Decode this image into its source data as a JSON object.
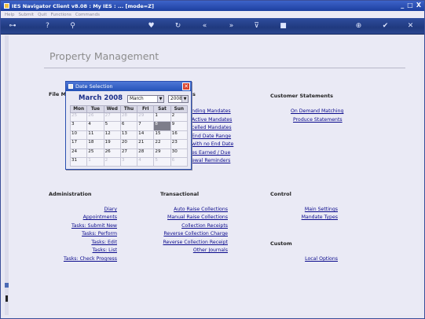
{
  "window": {
    "title": "IES Navigator Client v8.08 : My IES : ... [mode=Z]",
    "controls": [
      "_",
      "□",
      "X"
    ]
  },
  "menu": [
    "Help",
    "Submit",
    "Quit",
    "Functions",
    "Commands"
  ],
  "toolbar": {
    "icons": [
      "key-icon",
      "help-icon",
      "search-icon",
      "heart-icon",
      "refresh-icon",
      "back-icon",
      "forward-icon",
      "filter-icon",
      "stop-icon",
      "add-icon",
      "check-icon",
      "close-icon"
    ]
  },
  "page": {
    "title": "Property Management"
  },
  "sections": {
    "file_m": "File M",
    "customer_statements": "Customer Statements",
    "administration": "Administration",
    "transactional": "Transactional",
    "control": "Control",
    "custom": "Custom",
    "partial_heading_suffix": "s"
  },
  "links": {
    "mandates_partial": [
      "nding Mandates",
      "Active Mandates",
      "celled Mandates",
      "End Date Range",
      "with no End Date",
      "es Earned / Due",
      "ewal Reminders"
    ],
    "customer_statements": [
      "On Demand Matching",
      "Produce Statements"
    ],
    "administration": [
      "Diary",
      "Appointments",
      "Tasks: Submit New",
      "Tasks: Perform",
      "Tasks: Edit",
      "Tasks: List",
      "Tasks: Check Progress"
    ],
    "transactional": [
      "Auto Raise Collections",
      "Manual Raise Collections",
      "Collection Receipts",
      "Reverse Collection Charge",
      "Reverse Collection Receipt",
      "Other Journals"
    ],
    "control": [
      "Main Settings",
      "Mandate Types"
    ],
    "custom": [
      "Local Options"
    ]
  },
  "date_dialog": {
    "title": "Date Selection",
    "heading": "March 2008",
    "month_select": "March",
    "year_select": "2008",
    "weekdays": [
      "Mon",
      "Tue",
      "Wed",
      "Thu",
      "Fri",
      "Sat",
      "Sun"
    ],
    "weeks": [
      [
        "25",
        "26",
        "27",
        "28",
        "29",
        "1",
        "2"
      ],
      [
        "3",
        "4",
        "5",
        "6",
        "7",
        "8",
        "9"
      ],
      [
        "10",
        "11",
        "12",
        "13",
        "14",
        "15",
        "16"
      ],
      [
        "17",
        "18",
        "19",
        "20",
        "21",
        "22",
        "23"
      ],
      [
        "24",
        "25",
        "26",
        "27",
        "28",
        "29",
        "30"
      ],
      [
        "31",
        "1",
        "2",
        "3",
        "4",
        "5",
        "6"
      ]
    ],
    "selected_day": "8"
  }
}
